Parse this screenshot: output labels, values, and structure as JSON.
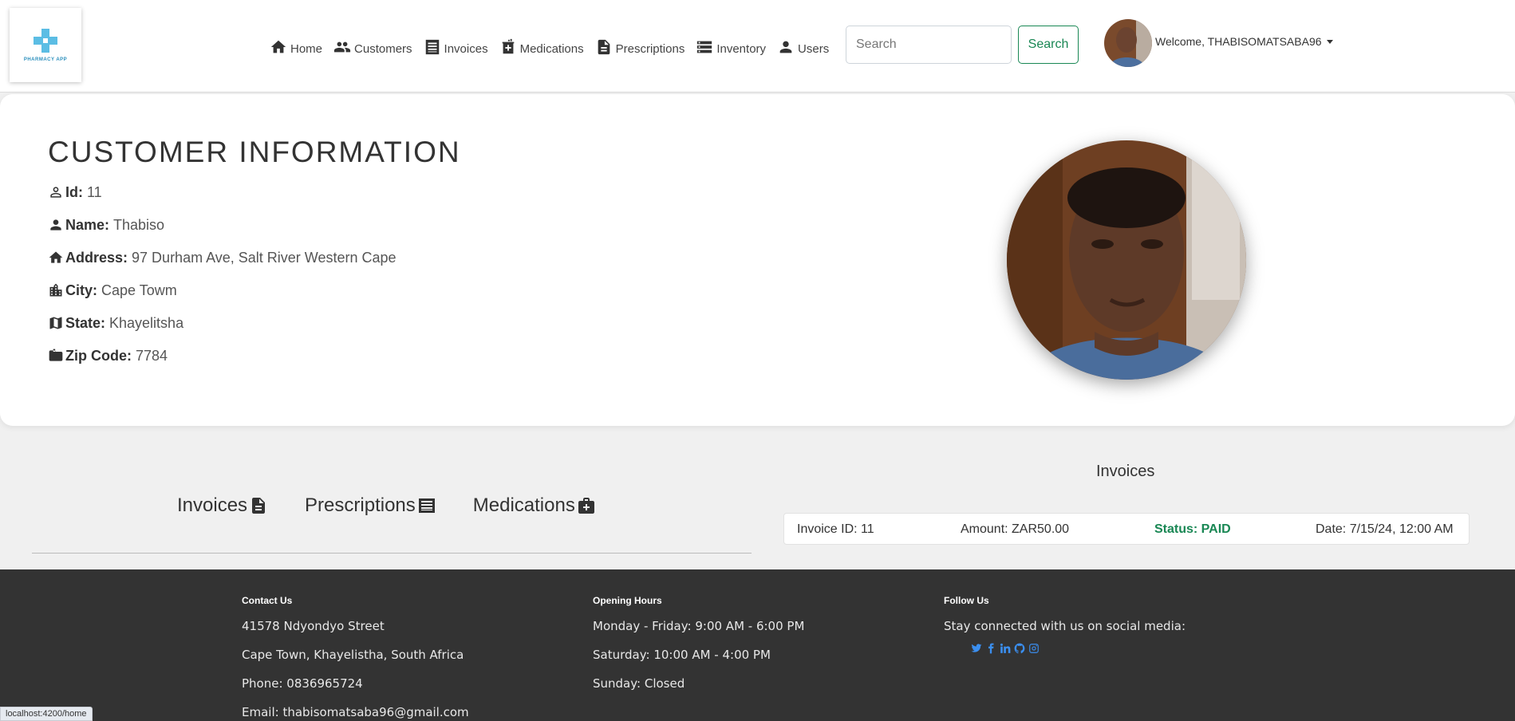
{
  "brand": {
    "logo_text": "PHARMACY APP"
  },
  "nav": {
    "items": [
      {
        "label": "Home",
        "icon": "home-icon"
      },
      {
        "label": "Customers",
        "icon": "people-icon"
      },
      {
        "label": "Invoices",
        "icon": "list-icon"
      },
      {
        "label": "Medications",
        "icon": "medical-box-icon"
      },
      {
        "label": "Prescriptions",
        "icon": "document-icon"
      },
      {
        "label": "Inventory",
        "icon": "storage-icon"
      },
      {
        "label": "Users",
        "icon": "user-icon"
      }
    ],
    "search_placeholder": "Search",
    "search_button": "Search",
    "welcome": "Welcome, THABISOMATSABA96"
  },
  "customer": {
    "title": "CUSTOMER INFORMATION",
    "fields": [
      {
        "label": "Id:",
        "value": "11",
        "icon": "person-outline-icon"
      },
      {
        "label": "Name:",
        "value": "Thabiso",
        "icon": "person-icon"
      },
      {
        "label": "Address:",
        "value": "97 Durham Ave, Salt River Western Cape",
        "icon": "home-icon"
      },
      {
        "label": "City:",
        "value": "Cape Towm",
        "icon": "city-icon"
      },
      {
        "label": "State:",
        "value": "Khayelitsha",
        "icon": "map-icon"
      },
      {
        "label": "Zip Code:",
        "value": "7784",
        "icon": "mailbox-icon"
      }
    ]
  },
  "tabs": [
    {
      "label": "Invoices",
      "icon": "invoice-icon"
    },
    {
      "label": "Prescriptions",
      "icon": "receipt-icon"
    },
    {
      "label": "Medications",
      "icon": "medkit-icon"
    }
  ],
  "invoices": {
    "heading": "Invoices",
    "rows": [
      {
        "id": "Invoice ID: 11",
        "amount": "Amount: ZAR50.00",
        "status": "Status: PAID",
        "date": "Date: 7/15/24, 12:00 AM"
      }
    ]
  },
  "footer": {
    "contact": {
      "heading": "Contact Us",
      "lines": [
        "41578 Ndyondyo Street",
        "Cape Town, Khayelistha, South Africa",
        "Phone: 0836965724",
        "Email: thabisomatsaba96@gmail.com"
      ]
    },
    "hours": {
      "heading": "Opening Hours",
      "lines": [
        "Monday - Friday: 9:00 AM - 6:00 PM",
        "Saturday: 10:00 AM - 4:00 PM",
        "Sunday: Closed"
      ]
    },
    "follow": {
      "heading": "Follow Us",
      "text": "Stay connected with us on social media:",
      "icons": [
        "twitter-icon",
        "facebook-icon",
        "linkedin-icon",
        "github-icon",
        "instagram-icon"
      ]
    }
  },
  "status_bar": {
    "url": "localhost:4200/home"
  },
  "colors": {
    "success": "#198754",
    "footer_bg": "#333333",
    "social_link": "#3b8ff0"
  }
}
